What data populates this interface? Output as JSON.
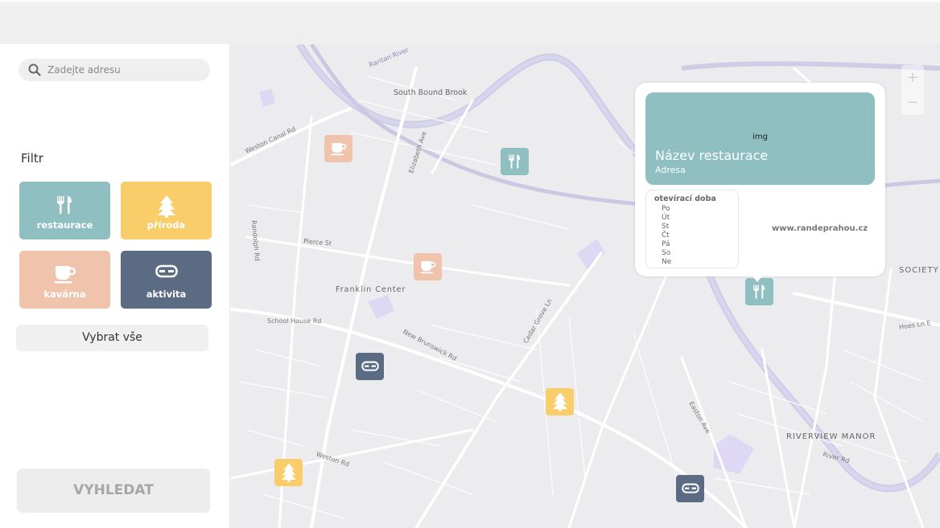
{
  "search": {
    "placeholder": "Zadejte adresu",
    "icon": "search-icon"
  },
  "filter": {
    "title": "Filtr",
    "categories": [
      {
        "label": "restaurace",
        "icon": "fork-knife-icon",
        "color": "#8fbfc1"
      },
      {
        "label": "příroda",
        "icon": "tree-icon",
        "color": "#f8cd6a"
      },
      {
        "label": "kavárna",
        "icon": "coffee-cup-icon",
        "color": "#efc3ac"
      },
      {
        "label": "aktivita",
        "icon": "mask-icon",
        "color": "#5b6b84"
      }
    ],
    "select_all": "Vybrat vše"
  },
  "search_button": "VYHLEDAT",
  "map": {
    "labels": {
      "south_bound_brook": "South Bound Brook",
      "franklin_center": "Franklin Center",
      "riverview_manor": "RIVERVIEW MANOR",
      "society_hill": "SOCIETY H",
      "raritan_river": "Raritan River",
      "school_house_rd": "School House Rd",
      "new_brunswick_rd": "New Brunswick Rd",
      "cedar_grove_ln": "Cedar Grove Ln",
      "easton_ave": "Easton Ave",
      "weston_canal_rd": "Weston Canal Rd",
      "elizabeth_ave": "Elizabeth Ave",
      "hoes_ln": "Hoes Ln E",
      "pierce_st": "Pierce St",
      "weston_rd": "Weston Rd",
      "randolph_rd": "Randolph Rd",
      "river_rd": "River Rd"
    },
    "zoom_in": "+",
    "zoom_out": "−"
  },
  "popup": {
    "image_placeholder": "img",
    "name": "Název restaurace",
    "address": "Adresa",
    "hours_title": "otevírací doba",
    "days": [
      "Po",
      "Út",
      "St",
      "Čt",
      "Pá",
      "So",
      "Ne"
    ],
    "website": "www.randeprahou.cz"
  }
}
